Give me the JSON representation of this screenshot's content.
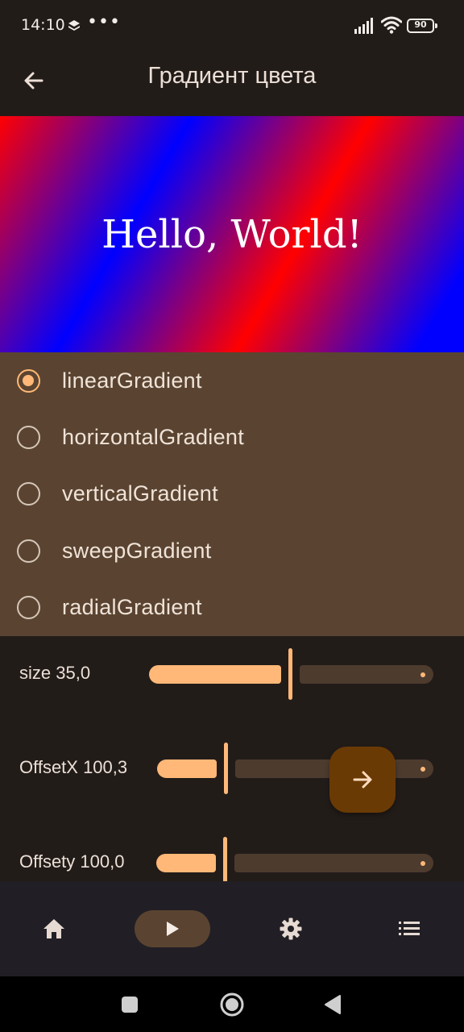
{
  "status_bar": {
    "time": "14:10",
    "dots": "•••",
    "battery": "90"
  },
  "app_bar": {
    "title": "Градиент цвета",
    "back_icon": "arrow-left-icon"
  },
  "preview": {
    "text": "Hello, World!",
    "gradient_colors": [
      "#ff0000",
      "#0000ff"
    ]
  },
  "radio_group": {
    "selected": "linearGradient",
    "options": [
      {
        "label": "linearGradient",
        "selected": true
      },
      {
        "label": "horizontalGradient",
        "selected": false
      },
      {
        "label": "verticalGradient",
        "selected": false
      },
      {
        "label": "sweepGradient",
        "selected": false
      },
      {
        "label": "radialGradient",
        "selected": false
      }
    ]
  },
  "sliders": [
    {
      "label": "size 35,0",
      "fraction": 0.5
    },
    {
      "label": "OffsetX 100,3",
      "fraction": 0.25
    },
    {
      "label": "Offsety 100,0",
      "fraction": 0.25
    }
  ],
  "fab": {
    "icon": "arrow-right-icon"
  },
  "bottom_nav": {
    "items": [
      {
        "icon": "home-icon",
        "active": false
      },
      {
        "icon": "play-icon",
        "active": true
      },
      {
        "icon": "gear-icon",
        "active": false
      },
      {
        "icon": "list-icon",
        "active": false
      }
    ]
  },
  "system_nav": {
    "buttons": [
      "recents-square-icon",
      "home-circle-icon",
      "back-triangle-icon"
    ]
  },
  "colors": {
    "accent": "#ffb877",
    "panel": "#5a4431",
    "background": "#221c19",
    "fab": "#6a3a05",
    "nav_bar": "#211f25"
  }
}
